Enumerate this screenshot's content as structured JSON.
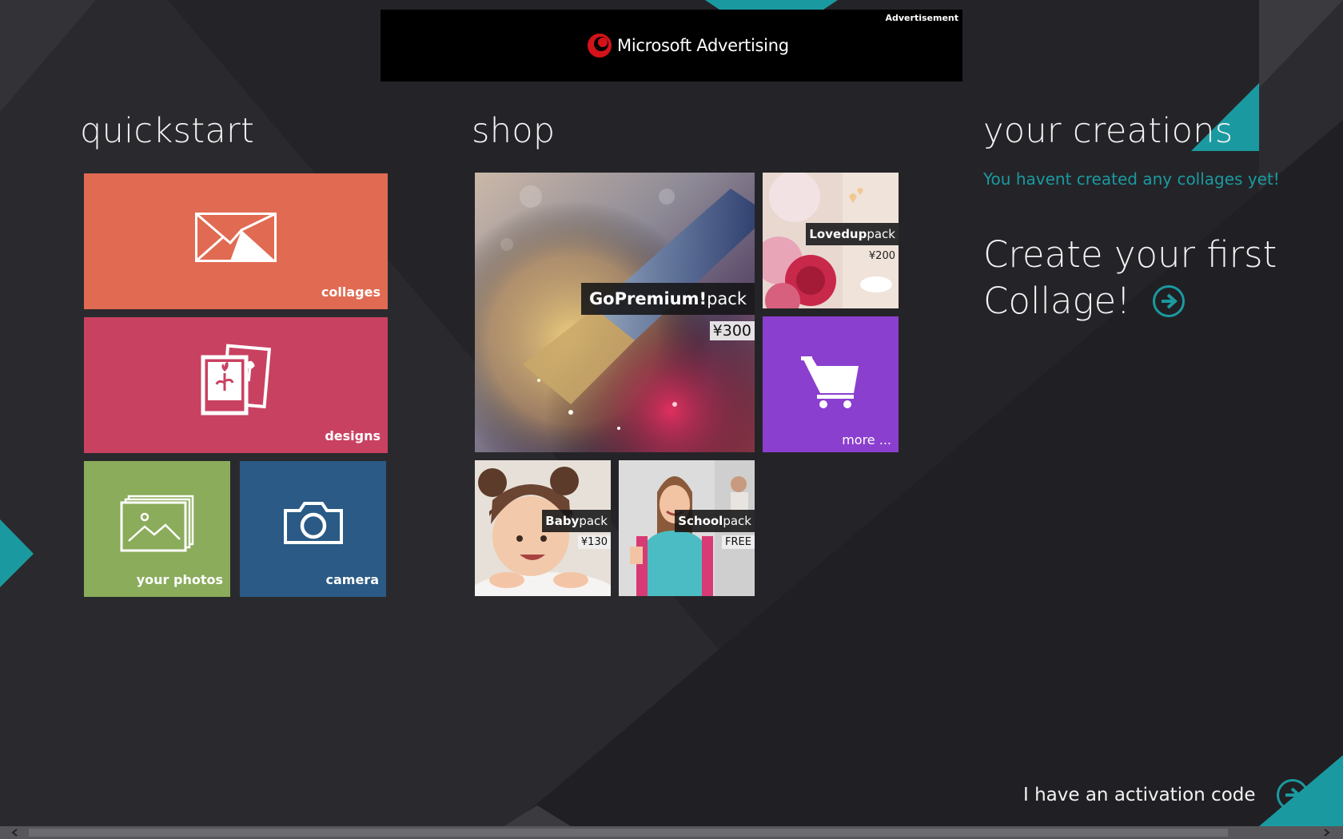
{
  "ad": {
    "label": "Advertisement",
    "brand": "Microsoft Advertising"
  },
  "quickstart": {
    "title": "quickstart",
    "tiles": [
      {
        "label": "collages",
        "color": "#e06b52"
      },
      {
        "label": "designs",
        "color": "#c94161"
      },
      {
        "label": "your photos",
        "color": "#8aac5b"
      },
      {
        "label": "camera",
        "color": "#2a5a85"
      }
    ]
  },
  "shop": {
    "title": "shop",
    "packs": [
      {
        "name": "GoPremium!",
        "suffix": "pack",
        "price": "¥300"
      },
      {
        "name": "Lovedup",
        "suffix": "pack",
        "price": "¥200"
      },
      {
        "name": "Baby",
        "suffix": "pack",
        "price": "¥130"
      },
      {
        "name": "School",
        "suffix": "pack",
        "price": "FREE"
      }
    ],
    "more": {
      "label": "more ...",
      "color": "#8b3fce"
    }
  },
  "creations": {
    "title": "your creations",
    "empty_message": "You havent created any collages yet!",
    "cta_line1": "Create your first",
    "cta_line2": "Collage!"
  },
  "activation": {
    "label": "I have an activation code"
  },
  "colors": {
    "accent": "#1a9aa0",
    "background": "#242428"
  }
}
